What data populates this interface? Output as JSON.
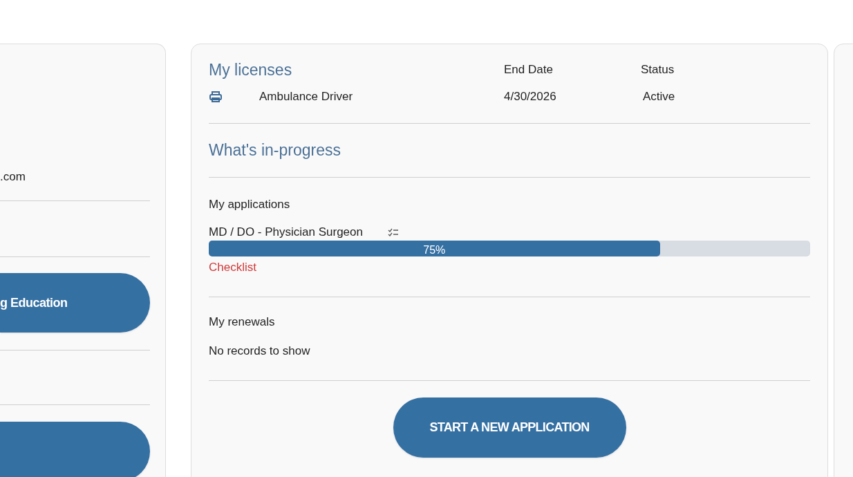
{
  "left_card": {
    "email_fragment": ".com",
    "button_label": "g Education"
  },
  "licenses": {
    "title": "My licenses",
    "columns": [
      "End Date",
      "Status"
    ],
    "rows": [
      {
        "name": "Ambulance Driver",
        "end_date": "4/30/2026",
        "status": "Active"
      }
    ]
  },
  "in_progress": {
    "title": "What's in-progress",
    "applications": {
      "label": "My applications",
      "items": [
        {
          "name": "MD / DO - Physician Surgeon",
          "level": 0.75,
          "percent": "75%",
          "link": "Checklist"
        }
      ]
    },
    "renewals": {
      "label": "My renewals",
      "empty": "No records to show"
    }
  },
  "start_button": "START A NEW APPLICATION"
}
